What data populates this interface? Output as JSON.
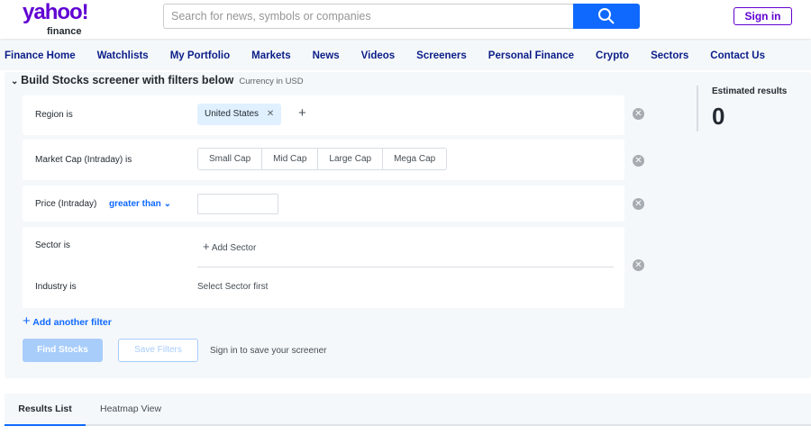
{
  "header": {
    "logo_main": "yahoo!",
    "logo_sub": "finance",
    "search_placeholder": "Search for news, symbols or companies",
    "sign_in": "Sign in"
  },
  "nav": [
    "Finance Home",
    "Watchlists",
    "My Portfolio",
    "Markets",
    "News",
    "Videos",
    "Screeners",
    "Personal Finance",
    "Crypto",
    "Sectors",
    "Contact Us"
  ],
  "screener": {
    "title": "Build Stocks screener with filters below",
    "currency": "Currency in USD",
    "region": {
      "label": "Region",
      "is": "is",
      "value": "United States"
    },
    "market_cap": {
      "label": "Market Cap (Intraday)",
      "is": "is",
      "options": [
        "Small Cap",
        "Mid Cap",
        "Large Cap",
        "Mega Cap"
      ]
    },
    "price": {
      "label": "Price (Intraday)",
      "operator": "greater than",
      "value": ""
    },
    "sector": {
      "label": "Sector",
      "is": "is",
      "add": "Add Sector"
    },
    "industry": {
      "label": "Industry",
      "is": "is",
      "placeholder": "Select Sector first"
    },
    "add_filter": "Add another filter",
    "find": "Find Stocks",
    "save": "Save Filters",
    "sign_in_note": "Sign in to save your screener"
  },
  "estimate": {
    "label": "Estimated results",
    "value": "0"
  },
  "tabs": [
    "Results List",
    "Heatmap View"
  ]
}
